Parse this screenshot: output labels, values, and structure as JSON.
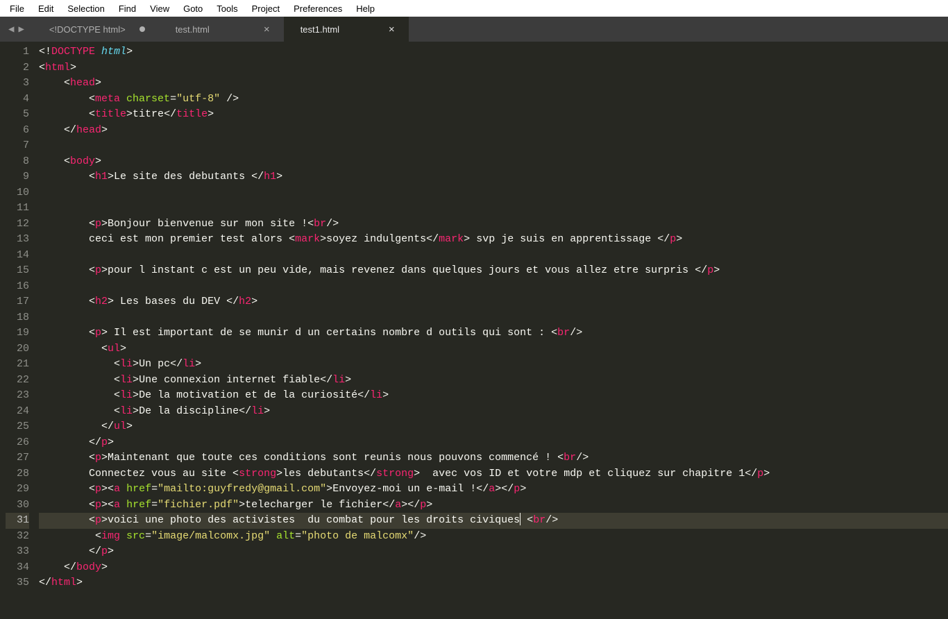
{
  "menu": [
    "File",
    "Edit",
    "Selection",
    "Find",
    "View",
    "Goto",
    "Tools",
    "Project",
    "Preferences",
    "Help"
  ],
  "tabs": [
    {
      "label": "<!DOCTYPE html>",
      "active": false,
      "dirty": true,
      "closable": false
    },
    {
      "label": "test.html",
      "active": false,
      "dirty": false,
      "closable": true
    },
    {
      "label": "test1.html",
      "active": true,
      "dirty": false,
      "closable": true
    }
  ],
  "line_numbers_count": 35,
  "highlight_line": 31,
  "code_lines": [
    [
      [
        "p",
        "<!"
      ],
      [
        "dt",
        "DOCTYPE"
      ],
      [
        "p",
        " "
      ],
      [
        "kw",
        "html"
      ],
      [
        "p",
        ">"
      ]
    ],
    [
      [
        "p",
        "<"
      ],
      [
        "tag",
        "html"
      ],
      [
        "p",
        ">"
      ]
    ],
    [
      [
        "p",
        "    <"
      ],
      [
        "tag",
        "head"
      ],
      [
        "p",
        ">"
      ]
    ],
    [
      [
        "p",
        "        <"
      ],
      [
        "tag",
        "meta"
      ],
      [
        "p",
        " "
      ],
      [
        "attr",
        "charset"
      ],
      [
        "p",
        "="
      ],
      [
        "str",
        "\"utf-8\""
      ],
      [
        "p",
        " />"
      ]
    ],
    [
      [
        "p",
        "        <"
      ],
      [
        "tag",
        "title"
      ],
      [
        "p",
        ">"
      ],
      [
        "txt",
        "titre"
      ],
      [
        "p",
        "</"
      ],
      [
        "tag",
        "title"
      ],
      [
        "p",
        ">"
      ]
    ],
    [
      [
        "p",
        "    </"
      ],
      [
        "tag",
        "head"
      ],
      [
        "p",
        ">"
      ]
    ],
    [],
    [
      [
        "p",
        "    <"
      ],
      [
        "tag",
        "body"
      ],
      [
        "p",
        ">"
      ]
    ],
    [
      [
        "p",
        "        <"
      ],
      [
        "tag",
        "h1"
      ],
      [
        "p",
        ">"
      ],
      [
        "txt",
        "Le site des debutants "
      ],
      [
        "p",
        "</"
      ],
      [
        "tag",
        "h1"
      ],
      [
        "p",
        ">"
      ]
    ],
    [],
    [],
    [
      [
        "p",
        "        <"
      ],
      [
        "tag",
        "p"
      ],
      [
        "p",
        ">"
      ],
      [
        "txt",
        "Bonjour bienvenue sur mon site !"
      ],
      [
        "p",
        "<"
      ],
      [
        "tag",
        "br"
      ],
      [
        "p",
        "/>"
      ]
    ],
    [
      [
        "txt",
        "        ceci est mon premier test alors "
      ],
      [
        "p",
        "<"
      ],
      [
        "tag",
        "mark"
      ],
      [
        "p",
        ">"
      ],
      [
        "txt",
        "soyez indulgents"
      ],
      [
        "p",
        "</"
      ],
      [
        "tag",
        "mark"
      ],
      [
        "p",
        ">"
      ],
      [
        "txt",
        " svp je suis en apprentissage "
      ],
      [
        "p",
        "</"
      ],
      [
        "tag",
        "p"
      ],
      [
        "p",
        ">"
      ]
    ],
    [],
    [
      [
        "p",
        "        <"
      ],
      [
        "tag",
        "p"
      ],
      [
        "p",
        ">"
      ],
      [
        "txt",
        "pour l instant c est un peu vide, mais revenez dans quelques jours et vous allez etre surpris "
      ],
      [
        "p",
        "</"
      ],
      [
        "tag",
        "p"
      ],
      [
        "p",
        ">"
      ]
    ],
    [],
    [
      [
        "p",
        "        <"
      ],
      [
        "tag",
        "h2"
      ],
      [
        "p",
        ">"
      ],
      [
        "txt",
        " Les bases du DEV "
      ],
      [
        "p",
        "</"
      ],
      [
        "tag",
        "h2"
      ],
      [
        "p",
        ">"
      ]
    ],
    [],
    [
      [
        "p",
        "        <"
      ],
      [
        "tag",
        "p"
      ],
      [
        "p",
        ">"
      ],
      [
        "txt",
        " Il est important de se munir d un certains nombre d outils qui sont : "
      ],
      [
        "p",
        "<"
      ],
      [
        "tag",
        "br"
      ],
      [
        "p",
        "/>"
      ]
    ],
    [
      [
        "p",
        "          <"
      ],
      [
        "tag",
        "ul"
      ],
      [
        "p",
        ">"
      ]
    ],
    [
      [
        "p",
        "            <"
      ],
      [
        "tag",
        "li"
      ],
      [
        "p",
        ">"
      ],
      [
        "txt",
        "Un pc"
      ],
      [
        "p",
        "</"
      ],
      [
        "tag",
        "li"
      ],
      [
        "p",
        ">"
      ]
    ],
    [
      [
        "p",
        "            <"
      ],
      [
        "tag",
        "li"
      ],
      [
        "p",
        ">"
      ],
      [
        "txt",
        "Une connexion internet fiable"
      ],
      [
        "p",
        "</"
      ],
      [
        "tag",
        "li"
      ],
      [
        "p",
        ">"
      ]
    ],
    [
      [
        "p",
        "            <"
      ],
      [
        "tag",
        "li"
      ],
      [
        "p",
        ">"
      ],
      [
        "txt",
        "De la motivation et de la curiosité"
      ],
      [
        "p",
        "</"
      ],
      [
        "tag",
        "li"
      ],
      [
        "p",
        ">"
      ]
    ],
    [
      [
        "p",
        "            <"
      ],
      [
        "tag",
        "li"
      ],
      [
        "p",
        ">"
      ],
      [
        "txt",
        "De la discipline"
      ],
      [
        "p",
        "</"
      ],
      [
        "tag",
        "li"
      ],
      [
        "p",
        ">"
      ]
    ],
    [
      [
        "p",
        "          </"
      ],
      [
        "tag",
        "ul"
      ],
      [
        "p",
        ">"
      ]
    ],
    [
      [
        "p",
        "        </"
      ],
      [
        "tag",
        "p"
      ],
      [
        "p",
        ">"
      ]
    ],
    [
      [
        "p",
        "        <"
      ],
      [
        "tag",
        "p"
      ],
      [
        "p",
        ">"
      ],
      [
        "txt",
        "Maintenant que toute ces conditions sont reunis nous pouvons commencé ! "
      ],
      [
        "p",
        "<"
      ],
      [
        "tag",
        "br"
      ],
      [
        "p",
        "/>"
      ]
    ],
    [
      [
        "txt",
        "        Connectez vous au site "
      ],
      [
        "p",
        "<"
      ],
      [
        "tag",
        "strong"
      ],
      [
        "p",
        ">"
      ],
      [
        "txt",
        "les debutants"
      ],
      [
        "p",
        "</"
      ],
      [
        "tag",
        "strong"
      ],
      [
        "p",
        ">"
      ],
      [
        "txt",
        "  avec vos ID et votre mdp et cliquez sur chapitre 1"
      ],
      [
        "p",
        "</"
      ],
      [
        "tag",
        "p"
      ],
      [
        "p",
        ">"
      ]
    ],
    [
      [
        "p",
        "        <"
      ],
      [
        "tag",
        "p"
      ],
      [
        "p",
        ">"
      ],
      [
        "p",
        "<"
      ],
      [
        "tag",
        "a"
      ],
      [
        "p",
        " "
      ],
      [
        "attr",
        "href"
      ],
      [
        "p",
        "="
      ],
      [
        "str",
        "\"mailto:guyfredy@gmail.com\""
      ],
      [
        "p",
        ">"
      ],
      [
        "txt",
        "Envoyez-moi un e-mail !"
      ],
      [
        "p",
        "</"
      ],
      [
        "tag",
        "a"
      ],
      [
        "p",
        ">"
      ],
      [
        "p",
        "</"
      ],
      [
        "tag",
        "p"
      ],
      [
        "p",
        ">"
      ]
    ],
    [
      [
        "p",
        "        <"
      ],
      [
        "tag",
        "p"
      ],
      [
        "p",
        ">"
      ],
      [
        "p",
        "<"
      ],
      [
        "tag",
        "a"
      ],
      [
        "p",
        " "
      ],
      [
        "attr",
        "href"
      ],
      [
        "p",
        "="
      ],
      [
        "str",
        "\"fichier.pdf\""
      ],
      [
        "p",
        ">"
      ],
      [
        "txt",
        "telecharger le fichier"
      ],
      [
        "p",
        "</"
      ],
      [
        "tag",
        "a"
      ],
      [
        "p",
        ">"
      ],
      [
        "p",
        "</"
      ],
      [
        "tag",
        "p"
      ],
      [
        "p",
        ">"
      ]
    ],
    [
      [
        "p",
        "        <"
      ],
      [
        "tag",
        "p"
      ],
      [
        "p",
        ">"
      ],
      [
        "txt",
        "voici une photo des activistes  du combat pour les droits civiques"
      ],
      [
        "cursor",
        ""
      ],
      [
        "txt",
        " "
      ],
      [
        "p",
        "<"
      ],
      [
        "tag",
        "br"
      ],
      [
        "p",
        "/>"
      ]
    ],
    [
      [
        "p",
        "         <"
      ],
      [
        "tag",
        "img"
      ],
      [
        "p",
        " "
      ],
      [
        "attr",
        "src"
      ],
      [
        "p",
        "="
      ],
      [
        "str",
        "\"image/malcomx.jpg\""
      ],
      [
        "p",
        " "
      ],
      [
        "attr",
        "alt"
      ],
      [
        "p",
        "="
      ],
      [
        "str",
        "\"photo de malcomx\""
      ],
      [
        "p",
        "/>"
      ]
    ],
    [
      [
        "p",
        "        </"
      ],
      [
        "tag",
        "p"
      ],
      [
        "p",
        ">"
      ]
    ],
    [
      [
        "p",
        "    </"
      ],
      [
        "tag",
        "body"
      ],
      [
        "p",
        ">"
      ]
    ],
    [
      [
        "p",
        "</"
      ],
      [
        "tag",
        "html"
      ],
      [
        "p",
        ">"
      ]
    ]
  ]
}
